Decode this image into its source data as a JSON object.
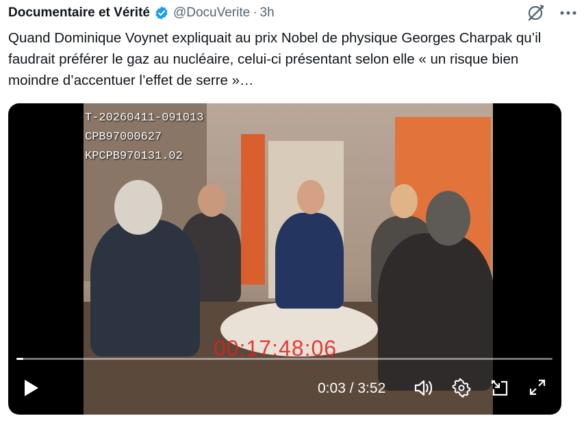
{
  "tweet": {
    "author_name": "Documentaire et Vérité",
    "handle": "@DocuVerite",
    "separator": "·",
    "time": "3h",
    "text": "Quand Dominique Voynet expliquait au prix Nobel de physique Georges Charpak qu’il faudrait préférer le gaz au nucléaire, celui-ci présentant selon elle « un risque bien moindre d’accentuer l’effet de serre »…"
  },
  "video": {
    "osd_lines": [
      "T-20260411-091013",
      "CPB97000627",
      "KPCPB970131.02"
    ],
    "timecode": "00:17:48:06",
    "current_time_display": "0:03 / 3:52",
    "progress_fraction": 0.013
  },
  "icons": {
    "verified": "verified-badge-icon",
    "grok": "grok-icon",
    "more": "more-icon",
    "play": "play-icon",
    "volume": "volume-icon",
    "settings": "settings-gear-icon",
    "dock": "dock-icon",
    "fullscreen": "fullscreen-icon"
  },
  "colors": {
    "verified_blue": "#1d9bf0",
    "secondary_text": "#536471",
    "timecode_red": "#e0201c"
  }
}
